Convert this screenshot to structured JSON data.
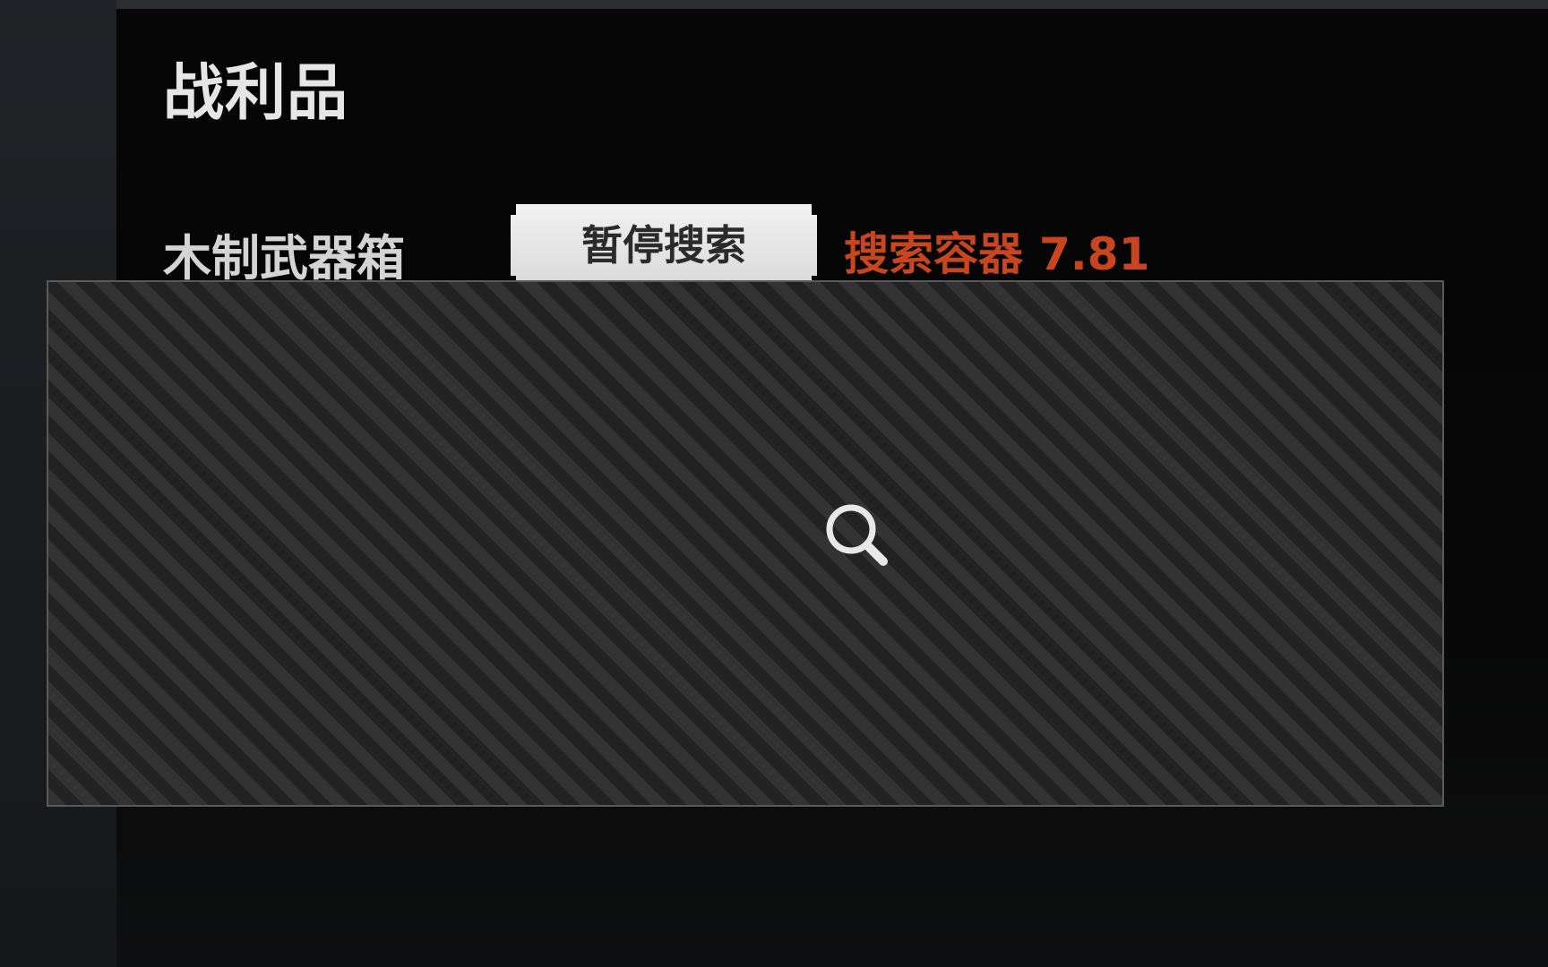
{
  "loot_panel": {
    "title": "战利品",
    "container": {
      "name": "木制武器箱",
      "pause_button_label": "暂停搜索",
      "search_status_label": "搜索容器",
      "search_timer": "7.81"
    },
    "grid_icon": "search-icon"
  },
  "colors": {
    "status_accent": "#c8461f",
    "button_bg": "#e4e4e4",
    "panel_bg": "#070707",
    "grid_stripe_light": "#333333",
    "grid_stripe_dark": "#222222"
  }
}
